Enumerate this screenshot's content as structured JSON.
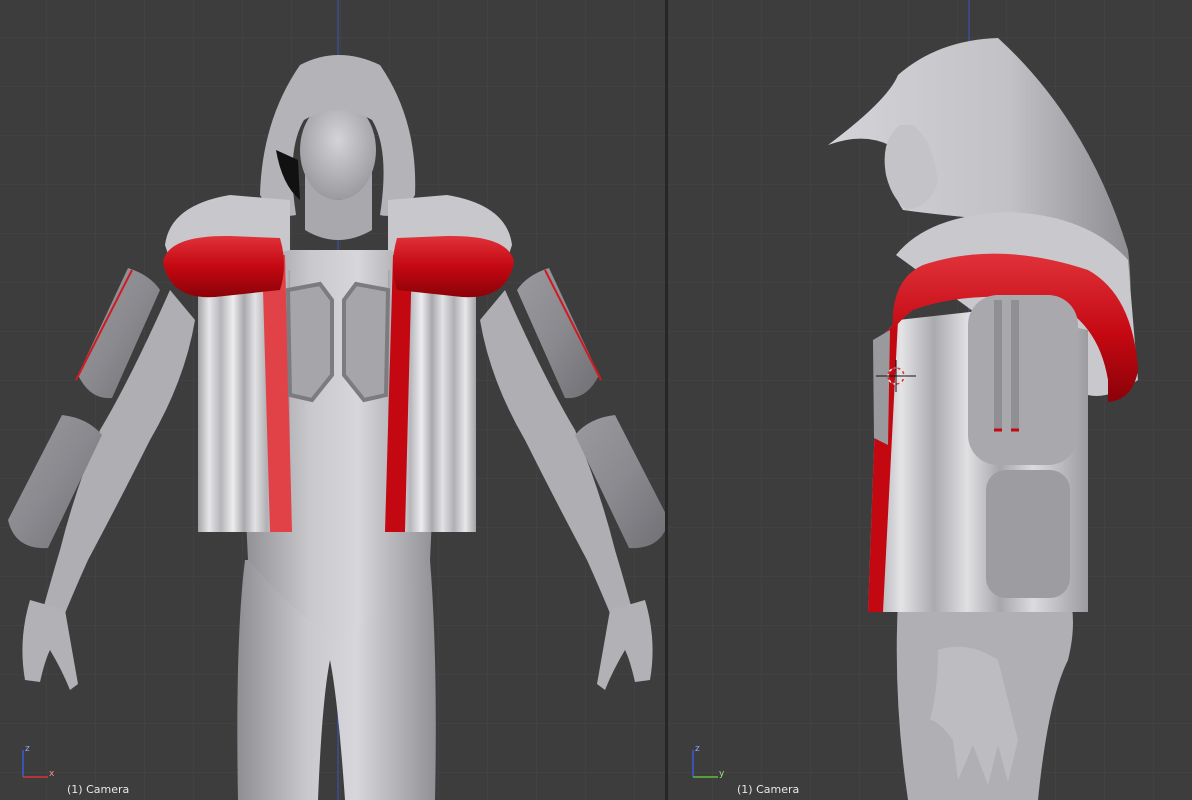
{
  "viewports": {
    "left": {
      "label": "(1) Camera",
      "view": "front",
      "axes": {
        "vertical": "z",
        "horizontal": "x"
      }
    },
    "right": {
      "label": "(1) Camera",
      "view": "side",
      "axes": {
        "vertical": "z",
        "horizontal": "y"
      }
    }
  },
  "colors": {
    "viewport_bg": "#3d3d3d",
    "grid": "#4a4a4a",
    "divider": "#262626",
    "model_gray": "#b9b9bd",
    "accent_red": "#c40812",
    "axis_x": "#d8343b",
    "axis_y": "#5fbf35",
    "axis_z": "#3b5bd6"
  }
}
